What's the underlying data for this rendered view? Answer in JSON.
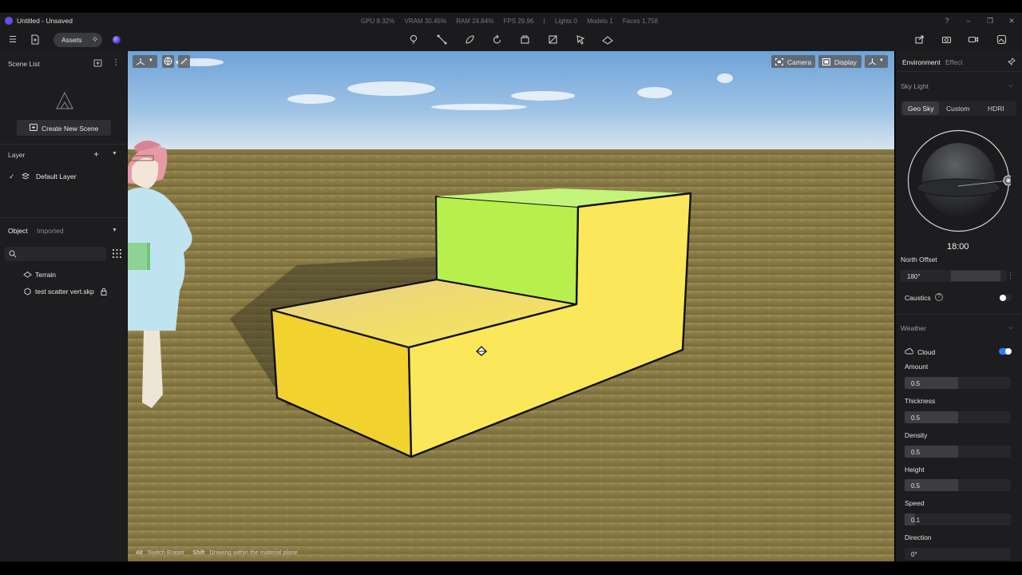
{
  "window": {
    "title": "Untitled - Unsaved",
    "stats": [
      "GPU 8.32%",
      "VRAM 30.45%",
      "RAM 24.84%",
      "FPS 29.96",
      "|",
      "Lights 0",
      "Models 1",
      "Faces 1,758"
    ],
    "controls": [
      "?",
      "–",
      "❐",
      "✕"
    ]
  },
  "toolbar": {
    "menu_icon": "menu-icon",
    "assets_label": "Assets",
    "tools": [
      "lightbulb-icon",
      "measure-icon",
      "paint-icon",
      "rotate-icon",
      "box-icon",
      "section-icon",
      "select-icon",
      "terrain-icon"
    ],
    "right_tools": [
      "share-icon",
      "camera-icon",
      "video-icon",
      "gallery-icon"
    ]
  },
  "left_panel": {
    "scene_list_title": "Scene List",
    "create_scene_label": "Create New Scene",
    "layer_title": "Layer",
    "default_layer": "Default Layer",
    "object_tab": "Object",
    "imported_tab": "Imported",
    "objects": [
      "Terrain",
      "test scatter vert.skp"
    ]
  },
  "viewport": {
    "camera_label": "Camera",
    "display_label": "Display",
    "hint_key1": "Alt",
    "hint_text1": "Switch Eraser",
    "hint_key2": "Shift",
    "hint_text2": "Drawing within the material plane"
  },
  "right_panel": {
    "tab_environment": "Environment",
    "tab_effect": "Effect",
    "sky_light_title": "Sky Light",
    "sky_modes": [
      "Geo Sky",
      "Custom",
      "HDRI"
    ],
    "time": "18:00",
    "north_offset_label": "North Offset",
    "north_offset_value": "180°",
    "caustics_label": "Caustics",
    "weather_title": "Weather",
    "cloud_label": "Cloud",
    "amount_label": "Amount",
    "amount_value": "0.5",
    "thickness_label": "Thickness",
    "thickness_value": "0.5",
    "density_label": "Density",
    "density_value": "0.5",
    "height_label": "Height",
    "height_value": "0.5",
    "speed_label": "Speed",
    "speed_value": "0.1",
    "direction_label": "Direction",
    "direction_value": "0°"
  },
  "colors": {
    "accent": "#2f7cf6",
    "brand": "#6b4de0"
  }
}
